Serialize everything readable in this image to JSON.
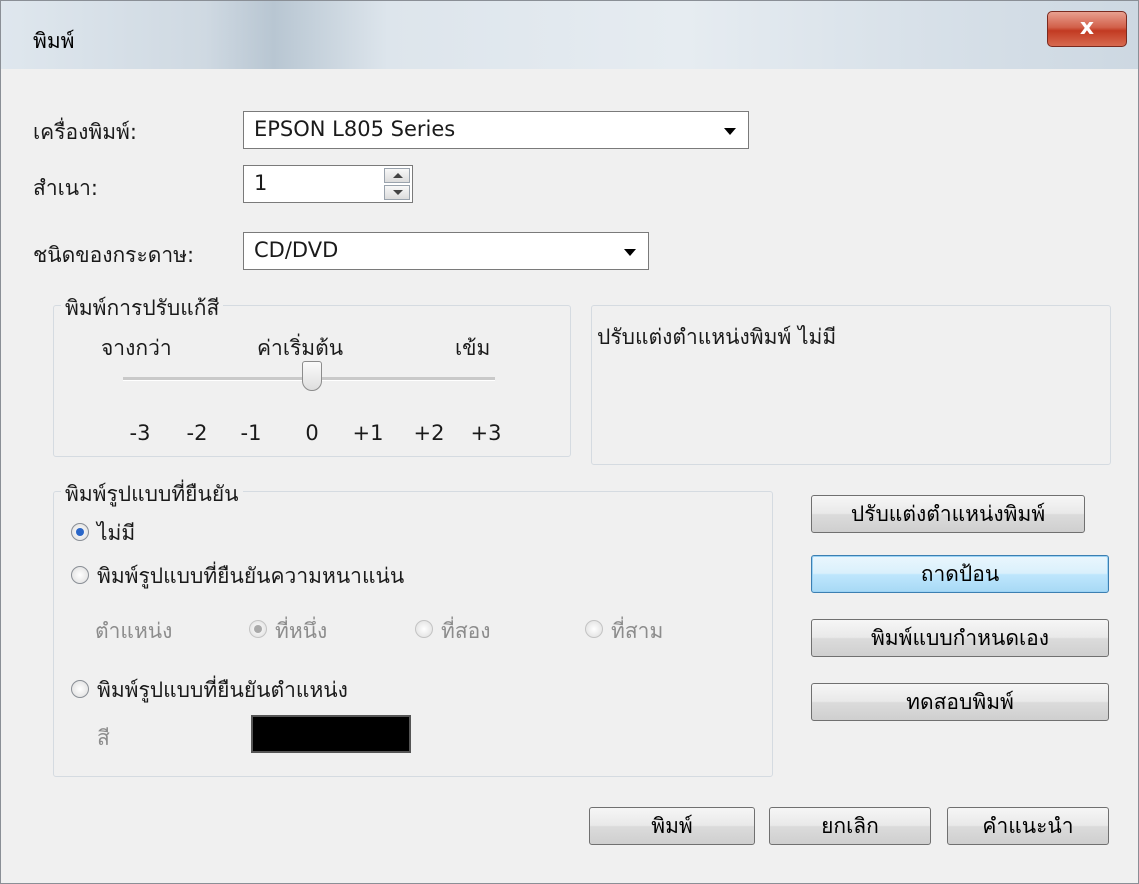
{
  "window": {
    "title": "พิมพ์",
    "close_label": "x"
  },
  "printer": {
    "label": "เครื่องพิมพ์:",
    "value": "EPSON L805 Series"
  },
  "copies": {
    "label": "สำเนา:",
    "value": "1"
  },
  "paper": {
    "label": "ชนิดของกระดาษ:",
    "value": "CD/DVD"
  },
  "color_density": {
    "title": "พิมพ์การปรับแก้สี",
    "min_label": "จางกว่า",
    "default_label": "ค่าเริ่มต้น",
    "max_label": "เข้ม",
    "ticks": [
      "-3",
      "-2",
      "-1",
      "0",
      "+1",
      "+2",
      "+3"
    ],
    "value": 0
  },
  "position_info": {
    "text": "ปรับแต่งตำแหน่งพิมพ์  ไม่มี"
  },
  "confirm_pattern": {
    "title": "พิมพ์รูปแบบที่ยืนยัน",
    "opt_none": "ไม่มี",
    "opt_density": "พิมพ์รูปแบบที่ยืนยันความหนาแน่น",
    "position_label": "ตำแหน่ง",
    "pos_first": "ที่หนึ่ง",
    "pos_second": "ที่สอง",
    "pos_third": "ที่สาม",
    "opt_position": "พิมพ์รูปแบบที่ยืนยันตำแหน่ง",
    "color_label": "สี",
    "color_value": "#000000"
  },
  "side_buttons": {
    "adjust": "ปรับแต่งตำแหน่งพิมพ์",
    "tray": "ถาดป้อน",
    "custom": "พิมพ์แบบกำหนดเอง",
    "test": "ทดสอบพิมพ์"
  },
  "footer": {
    "print": "พิมพ์",
    "cancel": "ยกเลิก",
    "help": "คำแนะนำ"
  }
}
